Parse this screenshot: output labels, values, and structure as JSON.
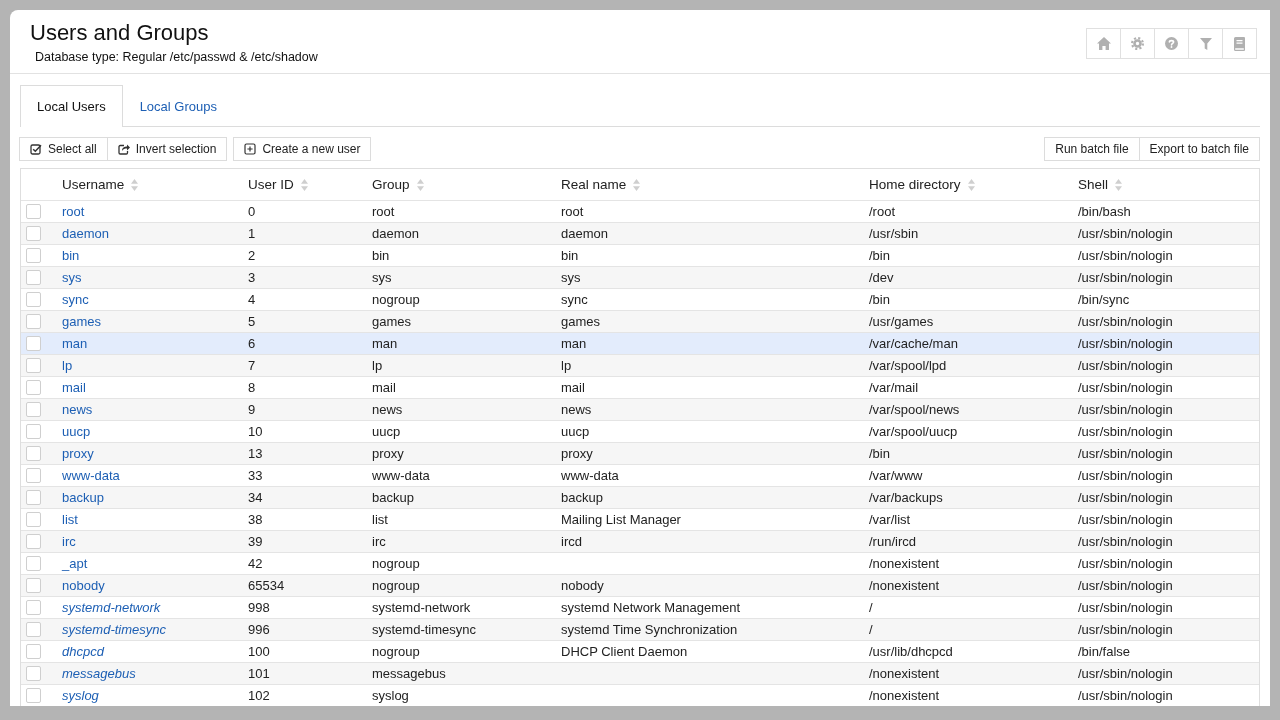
{
  "header": {
    "title": "Users and Groups",
    "subtitle": "Database type: Regular /etc/passwd & /etc/shadow"
  },
  "tabs": [
    {
      "label": "Local Users",
      "selected": true
    },
    {
      "label": "Local Groups",
      "selected": false
    }
  ],
  "toolbar": {
    "selection_buttons": [
      "Select all",
      "Invert selection"
    ],
    "create_button": "Create a new user",
    "batch_buttons": [
      "Run batch file",
      "Export to batch file"
    ]
  },
  "table": {
    "columns": [
      "Username",
      "User ID",
      "Group",
      "Real name",
      "Home directory",
      "Shell"
    ],
    "rows": [
      {
        "username": "root",
        "kind": "regular",
        "user_id": "0",
        "group": "root",
        "real_name": "root",
        "home_directory": "/root",
        "shell": "/bin/bash",
        "checked": false,
        "highlighted": false
      },
      {
        "username": "daemon",
        "kind": "regular",
        "user_id": "1",
        "group": "daemon",
        "real_name": "daemon",
        "home_directory": "/usr/sbin",
        "shell": "/usr/sbin/nologin",
        "checked": false,
        "highlighted": false
      },
      {
        "username": "bin",
        "kind": "regular",
        "user_id": "2",
        "group": "bin",
        "real_name": "bin",
        "home_directory": "/bin",
        "shell": "/usr/sbin/nologin",
        "checked": false,
        "highlighted": false
      },
      {
        "username": "sys",
        "kind": "regular",
        "user_id": "3",
        "group": "sys",
        "real_name": "sys",
        "home_directory": "/dev",
        "shell": "/usr/sbin/nologin",
        "checked": false,
        "highlighted": false
      },
      {
        "username": "sync",
        "kind": "regular",
        "user_id": "4",
        "group": "nogroup",
        "real_name": "sync",
        "home_directory": "/bin",
        "shell": "/bin/sync",
        "checked": false,
        "highlighted": false
      },
      {
        "username": "games",
        "kind": "regular",
        "user_id": "5",
        "group": "games",
        "real_name": "games",
        "home_directory": "/usr/games",
        "shell": "/usr/sbin/nologin",
        "checked": false,
        "highlighted": false
      },
      {
        "username": "man",
        "kind": "regular",
        "user_id": "6",
        "group": "man",
        "real_name": "man",
        "home_directory": "/var/cache/man",
        "shell": "/usr/sbin/nologin",
        "checked": false,
        "highlighted": true
      },
      {
        "username": "lp",
        "kind": "regular",
        "user_id": "7",
        "group": "lp",
        "real_name": "lp",
        "home_directory": "/var/spool/lpd",
        "shell": "/usr/sbin/nologin",
        "checked": false,
        "highlighted": false
      },
      {
        "username": "mail",
        "kind": "regular",
        "user_id": "8",
        "group": "mail",
        "real_name": "mail",
        "home_directory": "/var/mail",
        "shell": "/usr/sbin/nologin",
        "checked": false,
        "highlighted": false
      },
      {
        "username": "news",
        "kind": "regular",
        "user_id": "9",
        "group": "news",
        "real_name": "news",
        "home_directory": "/var/spool/news",
        "shell": "/usr/sbin/nologin",
        "checked": false,
        "highlighted": false
      },
      {
        "username": "uucp",
        "kind": "regular",
        "user_id": "10",
        "group": "uucp",
        "real_name": "uucp",
        "home_directory": "/var/spool/uucp",
        "shell": "/usr/sbin/nologin",
        "checked": false,
        "highlighted": false
      },
      {
        "username": "proxy",
        "kind": "regular",
        "user_id": "13",
        "group": "proxy",
        "real_name": "proxy",
        "home_directory": "/bin",
        "shell": "/usr/sbin/nologin",
        "checked": false,
        "highlighted": false
      },
      {
        "username": "www-data",
        "kind": "regular",
        "user_id": "33",
        "group": "www-data",
        "real_name": "www-data",
        "home_directory": "/var/www",
        "shell": "/usr/sbin/nologin",
        "checked": false,
        "highlighted": false
      },
      {
        "username": "backup",
        "kind": "regular",
        "user_id": "34",
        "group": "backup",
        "real_name": "backup",
        "home_directory": "/var/backups",
        "shell": "/usr/sbin/nologin",
        "checked": false,
        "highlighted": false
      },
      {
        "username": "list",
        "kind": "regular",
        "user_id": "38",
        "group": "list",
        "real_name": "Mailing List Manager",
        "home_directory": "/var/list",
        "shell": "/usr/sbin/nologin",
        "checked": false,
        "highlighted": false
      },
      {
        "username": "irc",
        "kind": "regular",
        "user_id": "39",
        "group": "irc",
        "real_name": "ircd",
        "home_directory": "/run/ircd",
        "shell": "/usr/sbin/nologin",
        "checked": false,
        "highlighted": false
      },
      {
        "username": "_apt",
        "kind": "regular",
        "user_id": "42",
        "group": "nogroup",
        "home_directory": "/nonexistent",
        "shell": "/usr/sbin/nologin",
        "checked": false,
        "highlighted": false
      },
      {
        "username": "nobody",
        "kind": "regular",
        "user_id": "65534",
        "group": "nogroup",
        "real_name": "nobody",
        "home_directory": "/nonexistent",
        "shell": "/usr/sbin/nologin",
        "checked": false,
        "highlighted": false
      },
      {
        "username": "systemd-network",
        "kind": "system",
        "user_id": "998",
        "group": "systemd-network",
        "real_name": "systemd Network Management",
        "home_directory": "/",
        "shell": "/usr/sbin/nologin",
        "checked": false,
        "highlighted": false
      },
      {
        "username": "systemd-timesync",
        "kind": "system",
        "user_id": "996",
        "group": "systemd-timesync",
        "real_name": "systemd Time Synchronization",
        "home_directory": "/",
        "shell": "/usr/sbin/nologin",
        "checked": false,
        "highlighted": false
      },
      {
        "username": "dhcpcd",
        "kind": "system",
        "user_id": "100",
        "group": "nogroup",
        "real_name": "DHCP Client Daemon",
        "home_directory": "/usr/lib/dhcpcd",
        "shell": "/bin/false",
        "checked": false,
        "highlighted": false
      },
      {
        "username": "messagebus",
        "kind": "system",
        "user_id": "101",
        "group": "messagebus",
        "home_directory": "/nonexistent",
        "shell": "/usr/sbin/nologin",
        "checked": false,
        "highlighted": false
      },
      {
        "username": "syslog",
        "kind": "system",
        "user_id": "102",
        "group": "syslog",
        "home_directory": "/nonexistent",
        "shell": "/usr/sbin/nologin",
        "checked": false,
        "highlighted": false
      }
    ]
  }
}
